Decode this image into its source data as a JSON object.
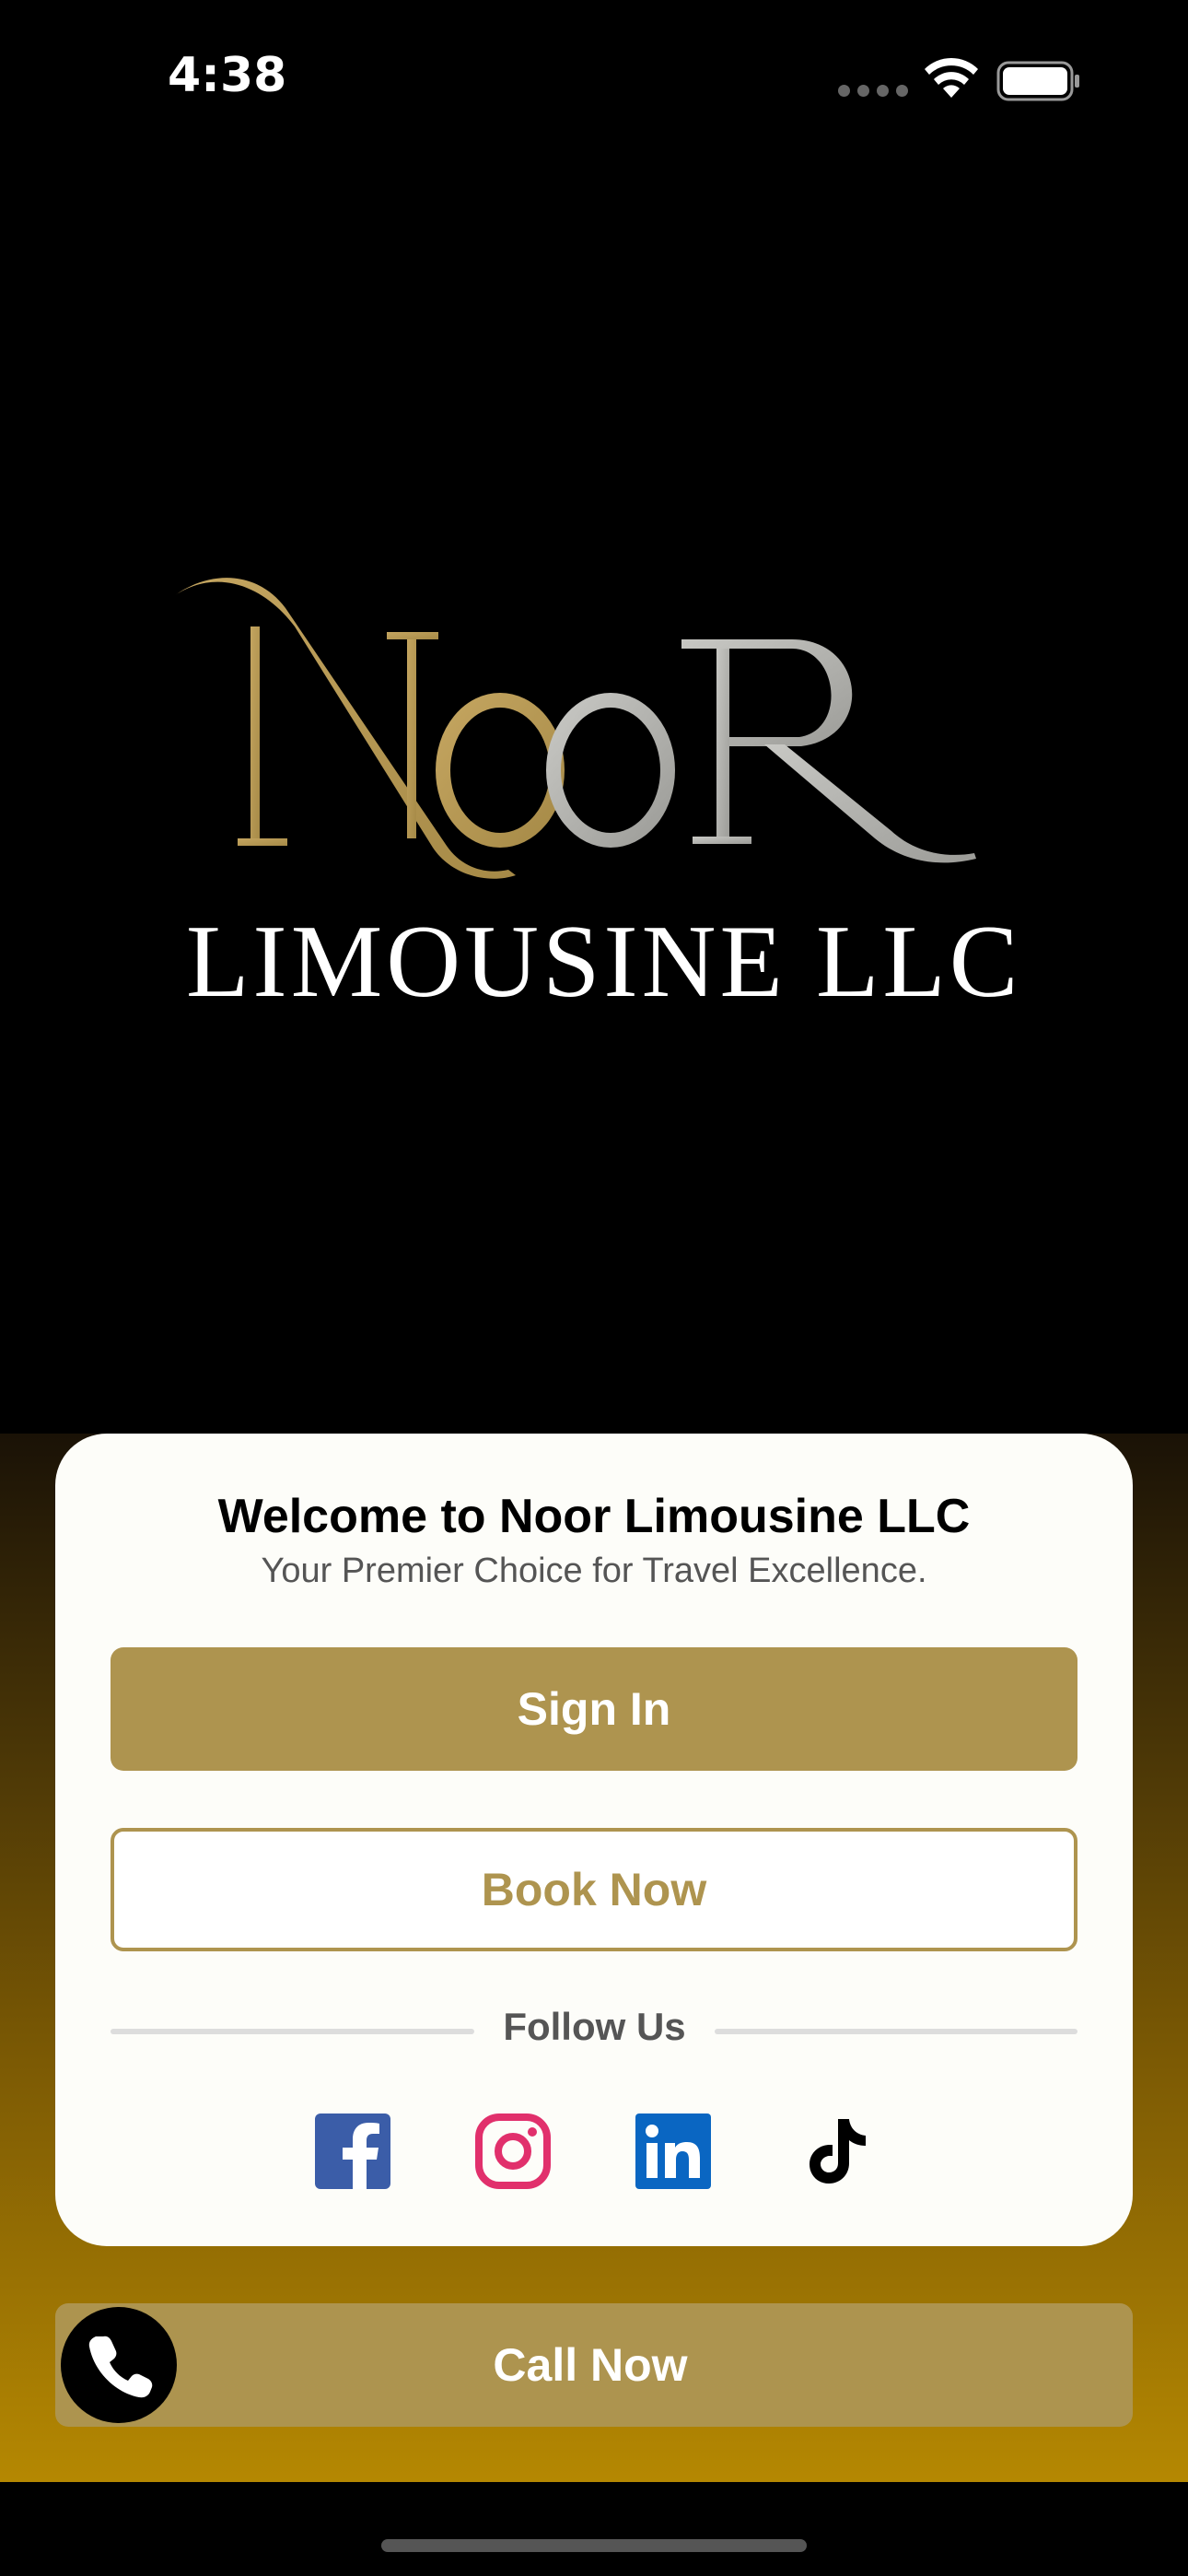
{
  "status_bar": {
    "time": "4:38"
  },
  "logo": {
    "wordmark": "NooR",
    "subtitle": "LIMOUSINE LLC"
  },
  "card": {
    "title": "Welcome to Noor Limousine LLC",
    "subtitle": "Your Premier Choice for Travel Excellence.",
    "sign_in_label": "Sign In",
    "book_now_label": "Book Now",
    "follow_label": "Follow Us",
    "social_icons": [
      "facebook-icon",
      "instagram-icon",
      "linkedin-icon",
      "tiktok-icon"
    ]
  },
  "call_now": {
    "label": "Call Now",
    "icon": "phone-icon"
  },
  "colors": {
    "accent_gold": "#ae944f",
    "card_bg": "#fdfdf9",
    "facebook": "#3b5da8",
    "instagram": "#e1306c",
    "linkedin": "#0a66c2"
  }
}
